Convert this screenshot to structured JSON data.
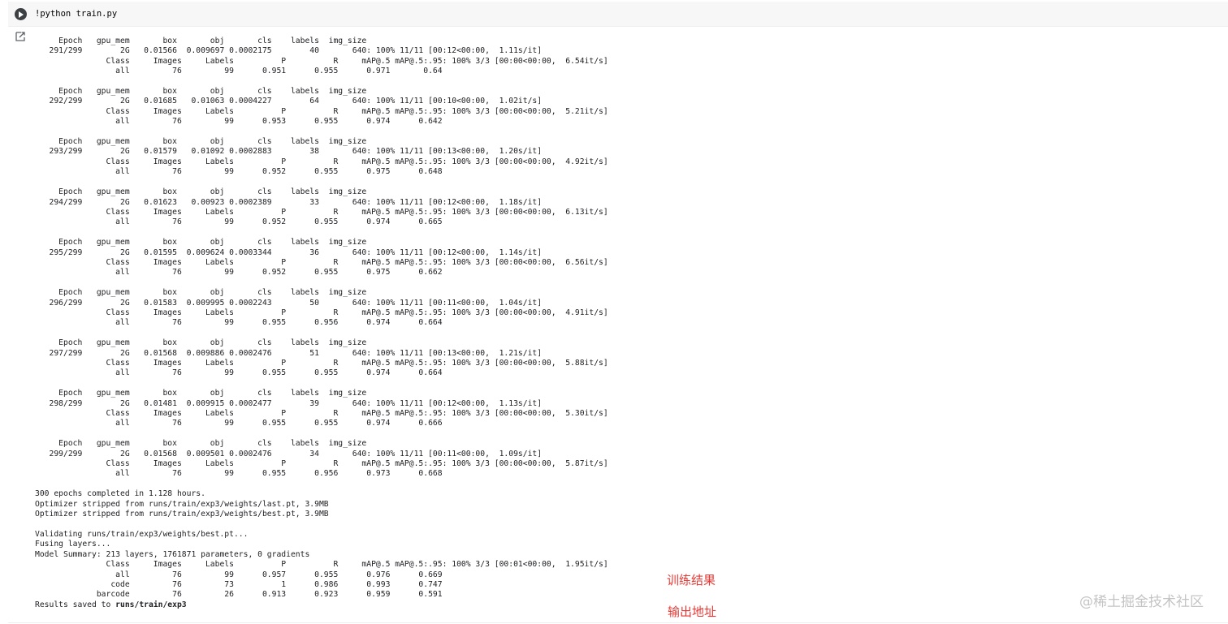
{
  "cell": {
    "code": "!python train.py"
  },
  "output": {
    "epochs": [
      {
        "header": "     Epoch   gpu_mem       box       obj       cls    labels  img_size",
        "train": "   291/299        2G   0.01566  0.009697 0.0002175        40       640: 100% 11/11 [00:12<00:00,  1.11s/it]",
        "val_header": "               Class     Images     Labels          P          R     mAP@.5 mAP@.5:.95: 100% 3/3 [00:00<00:00,  6.54it/s]",
        "val": "                 all         76         99      0.951      0.955      0.971       0.64"
      },
      {
        "header": "     Epoch   gpu_mem       box       obj       cls    labels  img_size",
        "train": "   292/299        2G   0.01685   0.01063 0.0004227        64       640: 100% 11/11 [00:10<00:00,  1.02it/s]",
        "val_header": "               Class     Images     Labels          P          R     mAP@.5 mAP@.5:.95: 100% 3/3 [00:00<00:00,  5.21it/s]",
        "val": "                 all         76         99      0.953      0.955      0.974      0.642"
      },
      {
        "header": "     Epoch   gpu_mem       box       obj       cls    labels  img_size",
        "train": "   293/299        2G   0.01579   0.01092 0.0002883        38       640: 100% 11/11 [00:13<00:00,  1.20s/it]",
        "val_header": "               Class     Images     Labels          P          R     mAP@.5 mAP@.5:.95: 100% 3/3 [00:00<00:00,  4.92it/s]",
        "val": "                 all         76         99      0.952      0.955      0.975      0.648"
      },
      {
        "header": "     Epoch   gpu_mem       box       obj       cls    labels  img_size",
        "train": "   294/299        2G   0.01623   0.00923 0.0002389        33       640: 100% 11/11 [00:12<00:00,  1.18s/it]",
        "val_header": "               Class     Images     Labels          P          R     mAP@.5 mAP@.5:.95: 100% 3/3 [00:00<00:00,  6.13it/s]",
        "val": "                 all         76         99      0.952      0.955      0.974      0.665"
      },
      {
        "header": "     Epoch   gpu_mem       box       obj       cls    labels  img_size",
        "train": "   295/299        2G   0.01595  0.009624 0.0003344        36       640: 100% 11/11 [00:12<00:00,  1.14s/it]",
        "val_header": "               Class     Images     Labels          P          R     mAP@.5 mAP@.5:.95: 100% 3/3 [00:00<00:00,  6.56it/s]",
        "val": "                 all         76         99      0.952      0.955      0.975      0.662"
      },
      {
        "header": "     Epoch   gpu_mem       box       obj       cls    labels  img_size",
        "train": "   296/299        2G   0.01583  0.009995 0.0002243        50       640: 100% 11/11 [00:11<00:00,  1.04s/it]",
        "val_header": "               Class     Images     Labels          P          R     mAP@.5 mAP@.5:.95: 100% 3/3 [00:00<00:00,  4.91it/s]",
        "val": "                 all         76         99      0.955      0.956      0.974      0.664"
      },
      {
        "header": "     Epoch   gpu_mem       box       obj       cls    labels  img_size",
        "train": "   297/299        2G   0.01568  0.009886 0.0002476        51       640: 100% 11/11 [00:13<00:00,  1.21s/it]",
        "val_header": "               Class     Images     Labels          P          R     mAP@.5 mAP@.5:.95: 100% 3/3 [00:00<00:00,  5.88it/s]",
        "val": "                 all         76         99      0.955      0.955      0.974      0.664"
      },
      {
        "header": "     Epoch   gpu_mem       box       obj       cls    labels  img_size",
        "train": "   298/299        2G   0.01481  0.009915 0.0002477        39       640: 100% 11/11 [00:12<00:00,  1.13s/it]",
        "val_header": "               Class     Images     Labels          P          R     mAP@.5 mAP@.5:.95: 100% 3/3 [00:00<00:00,  5.30it/s]",
        "val": "                 all         76         99      0.955      0.955      0.974      0.666"
      },
      {
        "header": "     Epoch   gpu_mem       box       obj       cls    labels  img_size",
        "train": "   299/299        2G   0.01568  0.009501 0.0002476        34       640: 100% 11/11 [00:11<00:00,  1.09s/it]",
        "val_header": "               Class     Images     Labels          P          R     mAP@.5 mAP@.5:.95: 100% 3/3 [00:00<00:00,  5.87it/s]",
        "val": "                 all         76         99      0.955      0.956      0.973      0.668"
      }
    ],
    "summary": {
      "completed": "300 epochs completed in 1.128 hours.",
      "stripped_last": "Optimizer stripped from runs/train/exp3/weights/last.pt, 3.9MB",
      "stripped_best": "Optimizer stripped from runs/train/exp3/weights/best.pt, 3.9MB",
      "validating": "Validating runs/train/exp3/weights/best.pt...",
      "fusing": "Fusing layers...",
      "model_summary": "Model Summary: 213 layers, 1761871 parameters, 0 gradients",
      "val_header": "               Class     Images     Labels          P          R     mAP@.5 mAP@.5:.95: 100% 3/3 [00:01<00:00,  1.95it/s]",
      "rows": [
        "                 all         76         99      0.957      0.955      0.976      0.669",
        "                code         76         73          1      0.986      0.993      0.747",
        "             barcode         76         26      0.913      0.923      0.959      0.591"
      ],
      "results_prefix": "Results saved to ",
      "results_path": "runs/train/exp3"
    }
  },
  "annotations": {
    "training_results": "训练结果",
    "output_path": "输出地址"
  },
  "watermark": "@稀土掘金技术社区",
  "colors": {
    "annotation": "#e53935",
    "run_button": "#3c4043",
    "cell_background": "#f7f7f7"
  },
  "icons": {
    "run": "play-icon",
    "output": "output-icon"
  }
}
